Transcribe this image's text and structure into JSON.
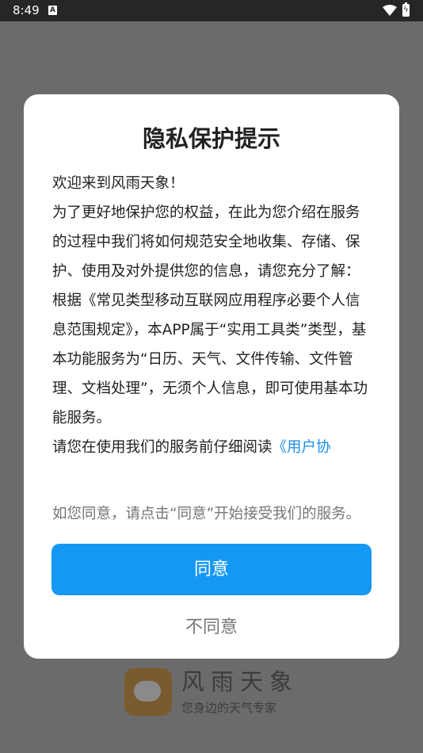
{
  "status_bar": {
    "time": "8:49",
    "notification_glyph": "A",
    "icons": [
      "wifi-icon",
      "battery-icon"
    ]
  },
  "background_brand": {
    "logo_icon": "weather-app-logo-icon",
    "name": "风雨天象",
    "slogan": "您身边的天气专家"
  },
  "dialog": {
    "title": "隐私保护提示",
    "paragraphs": [
      "欢迎来到风雨天象！",
      "为了更好地保护您的权益，在此为您介绍在服务的过程中我们将如何规范安全地收集、存储、保护、使用及对外提供您的信息，请您充分了解：",
      "根据《常见类型移动互联网应用程序必要个人信息范围规定》，本APP属于“实用工具类”类型，基本功能服务为“日历、天气、文件传输、文件管理、文档处理”，无须个人信息，即可使用基本功能服务。"
    ],
    "read_prompt": "请您在使用我们的服务前仔细阅读",
    "agreement_link": "《用户协",
    "hint": "如您同意，请点击“同意”开始接受我们的服务。",
    "agree_label": "同意",
    "disagree_label": "不同意"
  },
  "colors": {
    "overlay": "#6b6b6b",
    "status_bar": "#262626",
    "accent": "#1598f3",
    "link": "#1a8ee8",
    "hint_text": "#767676"
  }
}
